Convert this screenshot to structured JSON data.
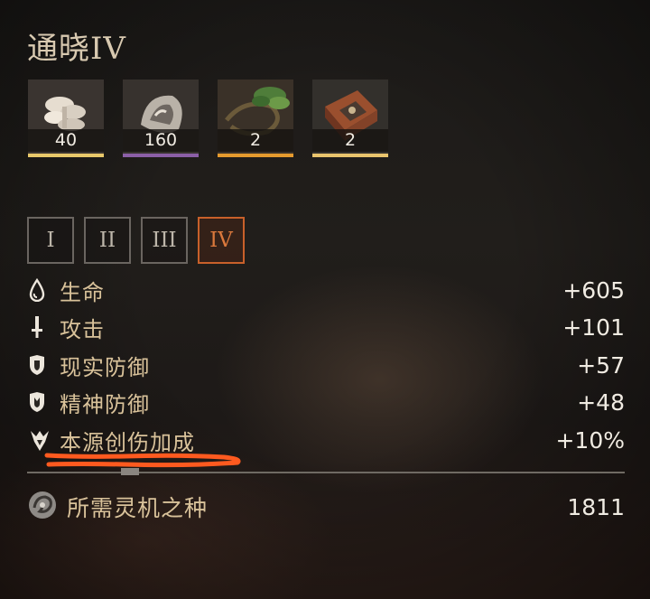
{
  "title": "通晓IV",
  "materials": [
    {
      "count": "40",
      "rarity_color": "#e8c86a",
      "icon": "white-fungus-icon"
    },
    {
      "count": "160",
      "rarity_color": "#8b5fa6",
      "icon": "grey-shell-icon"
    },
    {
      "count": "2",
      "rarity_color": "#e59a2e",
      "icon": "green-vine-icon"
    },
    {
      "count": "2",
      "rarity_color": "#e9c46d",
      "icon": "wooden-box-icon"
    }
  ],
  "tiers": [
    {
      "label": "I",
      "active": false
    },
    {
      "label": "II",
      "active": false
    },
    {
      "label": "III",
      "active": false
    },
    {
      "label": "IV",
      "active": true
    }
  ],
  "stats": [
    {
      "label": "生命",
      "value": "+605",
      "icon": "droplet-icon"
    },
    {
      "label": "攻击",
      "value": "+101",
      "icon": "sword-icon"
    },
    {
      "label": "现实防御",
      "value": "+57",
      "icon": "shield-icon"
    },
    {
      "label": "精神防御",
      "value": "+48",
      "icon": "spirit-shield-icon"
    },
    {
      "label": "本源创伤加成",
      "value": "+10%",
      "icon": "origin-damage-icon"
    }
  ],
  "cost": {
    "label": "所需灵机之种",
    "value": "1811",
    "icon": "seed-icon"
  },
  "colors": {
    "accent": "#c8602a",
    "label": "#d9c29a",
    "annotation": "#ff5a1f"
  }
}
